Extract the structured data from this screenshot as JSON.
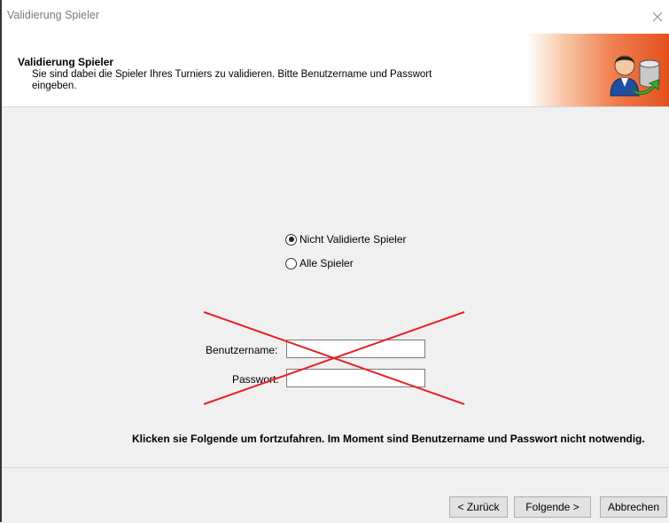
{
  "window": {
    "title": "Validierung Spieler"
  },
  "header": {
    "title": "Validierung Spieler",
    "description": "Sie sind dabei die Spieler Ihres Turniers zu validieren. Bitte Benutzername und Passwort eingeben.",
    "icon": "user-database-transfer-icon",
    "accent_color": "#e2501e"
  },
  "options": {
    "selected": "Nicht Validierte Spieler",
    "items": [
      {
        "label": "Nicht Validierte Spieler",
        "checked": true
      },
      {
        "label": "Alle Spieler",
        "checked": false
      }
    ]
  },
  "credentials": {
    "username_label": "Benutzername:",
    "username_value": "",
    "password_label": "Passwort:",
    "password_value": "",
    "crossed_out_color": "#e8202a"
  },
  "info_text": "Klicken sie Folgende um fortzufahren. Im Moment sind Benutzername und Passwort nicht notwendig.",
  "buttons": {
    "back": "< Zurück",
    "next": "Folgende >",
    "cancel": "Abbrechen"
  }
}
